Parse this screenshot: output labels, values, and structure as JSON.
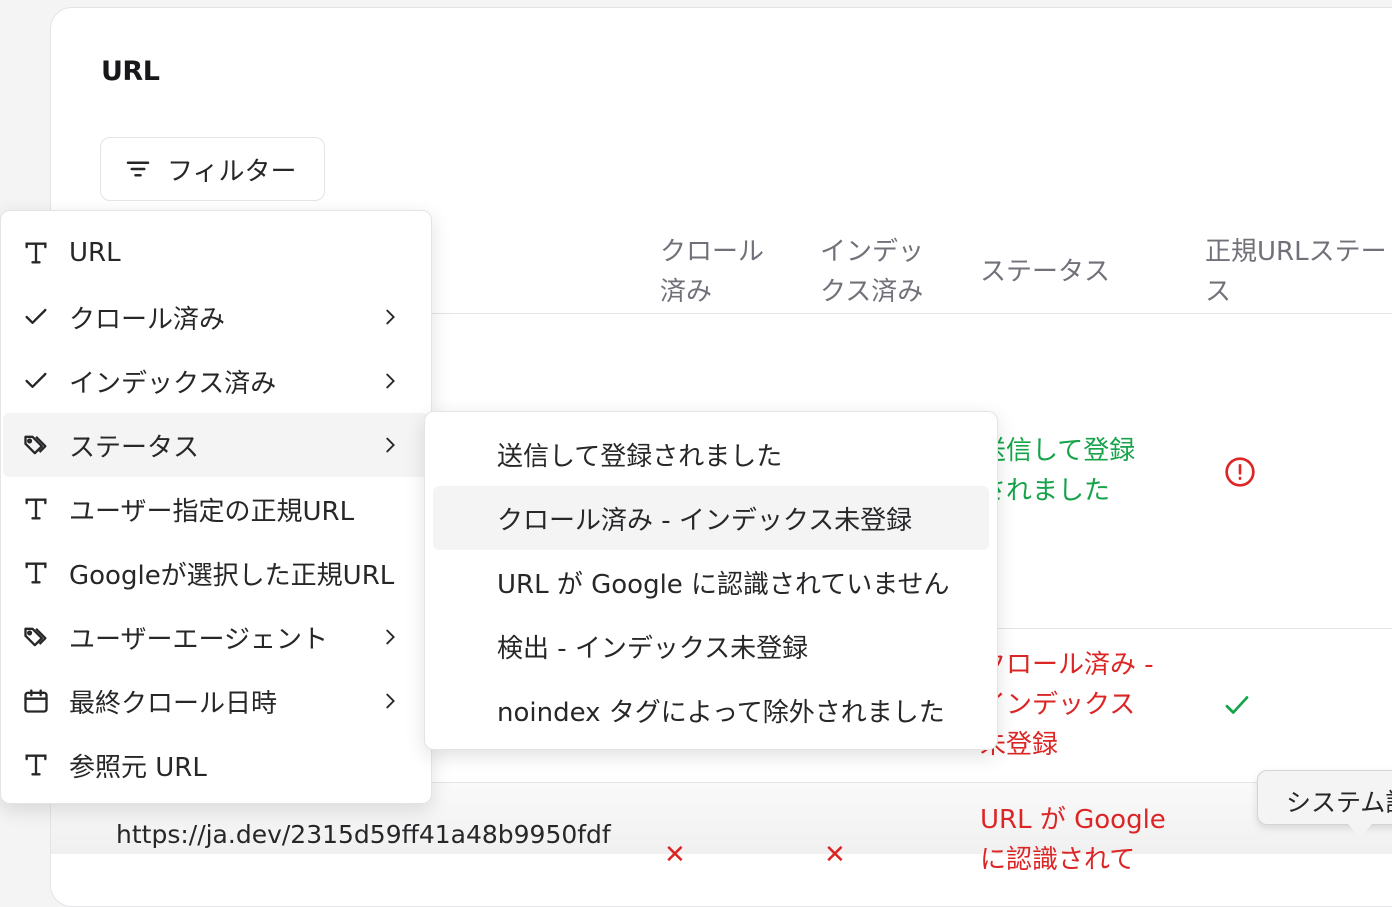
{
  "title": "URL",
  "filter_button": {
    "label": "フィルター",
    "icon": "filter-icon"
  },
  "table": {
    "headers": {
      "crawled": [
        "クロール",
        "済み"
      ],
      "indexed": [
        "インデッ",
        "クス済み"
      ],
      "status": "ステータス",
      "canonical_status": [
        "正規URLステー",
        "ス"
      ]
    },
    "rows": [
      {
        "status_lines": [
          "送信して登録",
          "されました"
        ],
        "status_color": "#16a34a",
        "canonical_icon": "alert-circle-icon"
      },
      {
        "status_lines": [
          "クロール済み -",
          "インデックス",
          "未登録"
        ],
        "status_color": "#dc2626",
        "canonical_icon": "check-icon"
      },
      {
        "url": "https://ja.dev/2315d59ff41a48b9950fdf",
        "crawled": "✕",
        "indexed": "✕",
        "status_lines": [
          "URL が Google",
          "に認識されて"
        ],
        "status_color": "#dc2626"
      }
    ]
  },
  "menu": {
    "items": [
      {
        "label": "URL",
        "icon": "text-icon",
        "submenu": false
      },
      {
        "label": "クロール済み",
        "icon": "check-icon",
        "submenu": true
      },
      {
        "label": "インデックス済み",
        "icon": "check-icon",
        "submenu": true
      },
      {
        "label": "ステータス",
        "icon": "tags-icon",
        "submenu": true,
        "active": true
      },
      {
        "label": "ユーザー指定の正規URL",
        "icon": "text-icon",
        "submenu": false
      },
      {
        "label": "Googleが選択した正規URL",
        "icon": "text-icon",
        "submenu": false
      },
      {
        "label": "ユーザーエージェント",
        "icon": "tags-icon",
        "submenu": true
      },
      {
        "label": "最終クロール日時",
        "icon": "calendar-icon",
        "submenu": true
      },
      {
        "label": "参照元 URL",
        "icon": "text-icon",
        "submenu": false
      }
    ]
  },
  "submenu": {
    "items": [
      "送信して登録されました",
      "クロール済み - インデックス未登録",
      "URL が Google に認識されていません",
      "検出 - インデックス未登録",
      "noindex タグによって除外されました"
    ],
    "hovered_index": 1
  },
  "tooltip": {
    "text": "システム設"
  },
  "colors": {
    "success": "#16a34a",
    "danger": "#dc2626",
    "muted": "#71717a"
  }
}
